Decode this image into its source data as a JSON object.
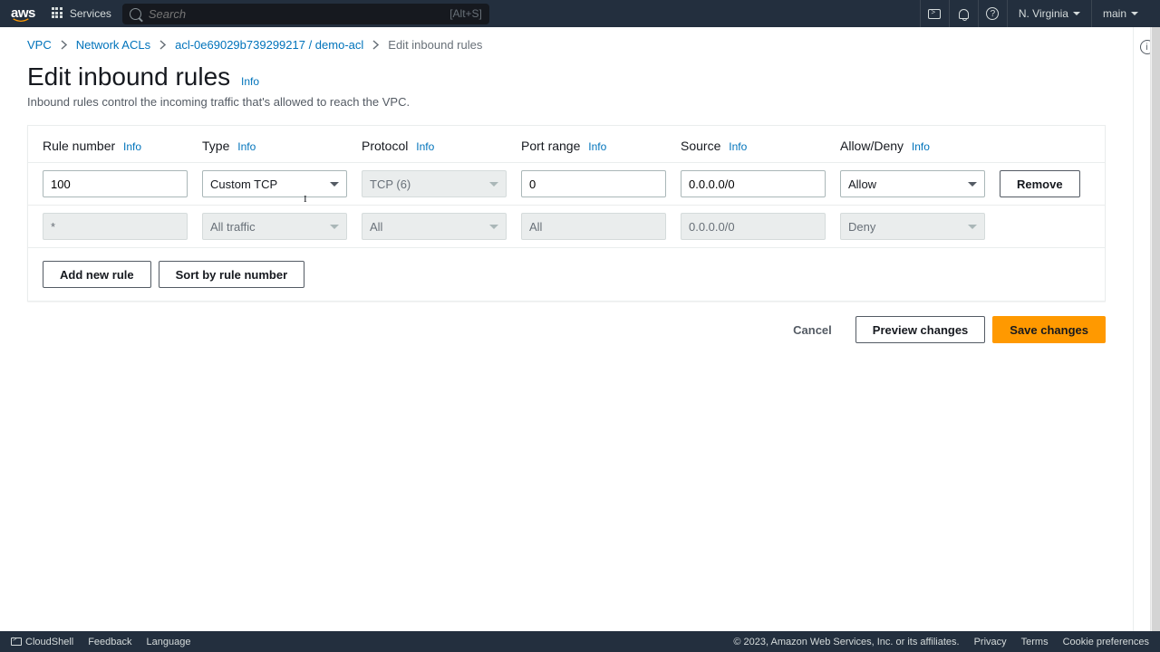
{
  "topnav": {
    "logo": "aws",
    "services": "Services",
    "search_placeholder": "Search",
    "search_hint": "[Alt+S]",
    "region": "N. Virginia",
    "user": "main"
  },
  "breadcrumbs": {
    "items": [
      "VPC",
      "Network ACLs",
      "acl-0e69029b739299217 / demo-acl"
    ],
    "current": "Edit inbound rules"
  },
  "page": {
    "title": "Edit inbound rules",
    "info": "Info",
    "subtitle": "Inbound rules control the incoming traffic that's allowed to reach the VPC."
  },
  "columns": {
    "rule_number": "Rule number",
    "type": "Type",
    "protocol": "Protocol",
    "port_range": "Port range",
    "source": "Source",
    "allow_deny": "Allow/Deny",
    "info": "Info"
  },
  "rules": [
    {
      "rule_number": "100",
      "type": "Custom TCP",
      "protocol": "TCP (6)",
      "port_range": "0",
      "source": "0.0.0.0/0",
      "allow_deny": "Allow",
      "editable": true,
      "protocol_disabled": true
    },
    {
      "rule_number": "*",
      "type": "All traffic",
      "protocol": "All",
      "port_range": "All",
      "source": "0.0.0.0/0",
      "allow_deny": "Deny",
      "editable": false
    }
  ],
  "buttons": {
    "remove": "Remove",
    "add_rule": "Add new rule",
    "sort": "Sort by rule number",
    "cancel": "Cancel",
    "preview": "Preview changes",
    "save": "Save changes"
  },
  "footer": {
    "cloudshell": "CloudShell",
    "feedback": "Feedback",
    "language": "Language",
    "copyright": "© 2023, Amazon Web Services, Inc. or its affiliates.",
    "privacy": "Privacy",
    "terms": "Terms",
    "cookies": "Cookie preferences"
  }
}
